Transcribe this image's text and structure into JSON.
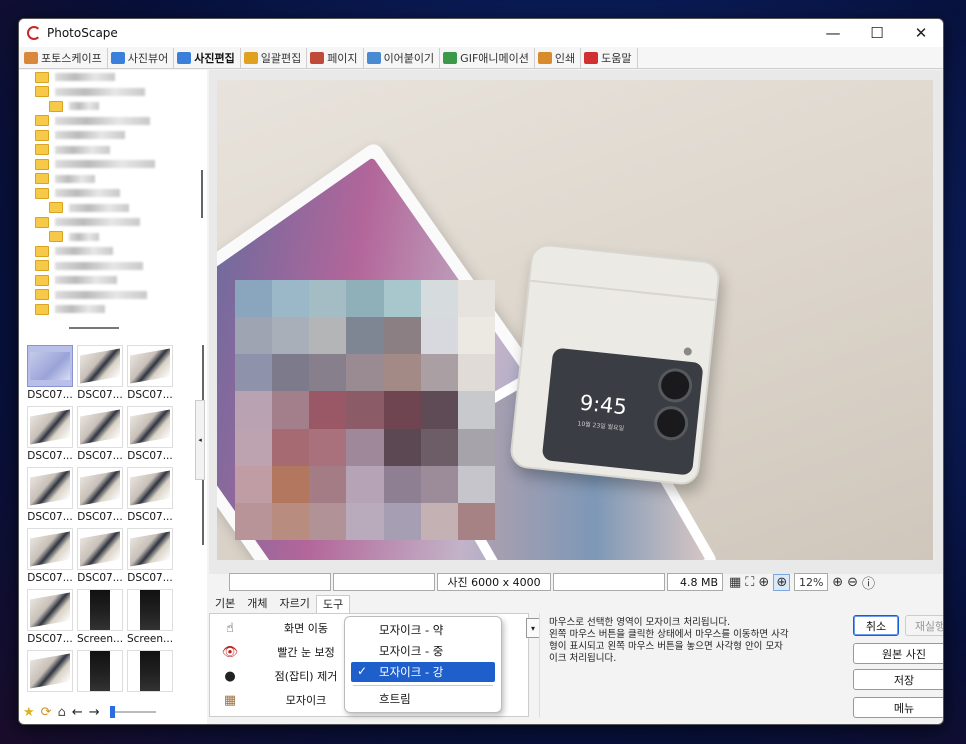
{
  "window": {
    "title": "PhotoScape",
    "controls": [
      "—",
      "☐",
      "✕"
    ]
  },
  "tabs": [
    {
      "label": "포토스케이프",
      "color": "#d9873a",
      "active": false
    },
    {
      "label": "사진뷰어",
      "color": "#3a7fd9",
      "active": false
    },
    {
      "label": "사진편집",
      "color": "#3a7fd9",
      "active": true
    },
    {
      "label": "일괄편집",
      "color": "#e0a020",
      "active": false
    },
    {
      "label": "페이지",
      "color": "#c04a3a",
      "active": false
    },
    {
      "label": "이어붙이기",
      "color": "#4a8ad0",
      "active": false
    },
    {
      "label": "GIF애니메이션",
      "color": "#3a9a4a",
      "active": false
    },
    {
      "label": "인쇄",
      "color": "#d98a2a",
      "active": false
    },
    {
      "label": "도움말",
      "color": "#d03030",
      "active": false
    }
  ],
  "thumbnails": [
    {
      "label": "DSC07...",
      "kind": "sel"
    },
    {
      "label": "DSC07...",
      "kind": "photo"
    },
    {
      "label": "DSC07...",
      "kind": "photo"
    },
    {
      "label": "DSC07...",
      "kind": "photo"
    },
    {
      "label": "DSC07...",
      "kind": "photo"
    },
    {
      "label": "DSC07...",
      "kind": "photo"
    },
    {
      "label": "DSC07...",
      "kind": "photo"
    },
    {
      "label": "DSC07...",
      "kind": "photo"
    },
    {
      "label": "DSC07...",
      "kind": "photo"
    },
    {
      "label": "DSC07...",
      "kind": "photo"
    },
    {
      "label": "DSC07...",
      "kind": "photo"
    },
    {
      "label": "DSC07...",
      "kind": "photo"
    },
    {
      "label": "DSC07...",
      "kind": "photo"
    },
    {
      "label": "Screen...",
      "kind": "dark"
    },
    {
      "label": "Screen...",
      "kind": "dark"
    },
    {
      "label": "",
      "kind": "photo"
    },
    {
      "label": "",
      "kind": "dark"
    },
    {
      "label": "",
      "kind": "dark"
    }
  ],
  "photo": {
    "clock": "9:45",
    "date": "10월 23일 월요일"
  },
  "status": {
    "dimensions": "사진 6000 x 4000",
    "filesize": "4.8 MB",
    "zoom": "12%"
  },
  "tool_tabs": [
    "기본",
    "개체",
    "자르기",
    "도구"
  ],
  "tools": [
    {
      "label": "화면 이동",
      "icon": "hand-icon",
      "glyph": "☝"
    },
    {
      "label": "빨간 눈 보정",
      "icon": "red-eye-icon",
      "glyph": "👁"
    },
    {
      "label": "점(잡티) 제거",
      "icon": "spot-removal-icon",
      "glyph": "●"
    },
    {
      "label": "모자이크",
      "icon": "mosaic-icon",
      "glyph": "▦"
    }
  ],
  "dropdown": {
    "items": [
      {
        "label": "모자이크 - 약",
        "checked": false
      },
      {
        "label": "모자이크 - 중",
        "checked": false
      },
      {
        "label": "모자이크 - 강",
        "checked": true
      },
      {
        "label": "흐트림",
        "checked": false
      }
    ]
  },
  "description": "마우스로 선택한 영역이 모자이크 처리됩니다.\n왼쪽 마우스 버튼을 클릭한 상태에서 마우스를 이동하면 사각\n형이 표시되고 왼쪽 마우스 버튼을 놓으면 사각형 안이 모자\n이크 처리됩니다.",
  "buttons": {
    "cancel": "취소",
    "redo": "재실행",
    "original": "원본 사진",
    "save": "저장",
    "menu": "메뉴"
  }
}
